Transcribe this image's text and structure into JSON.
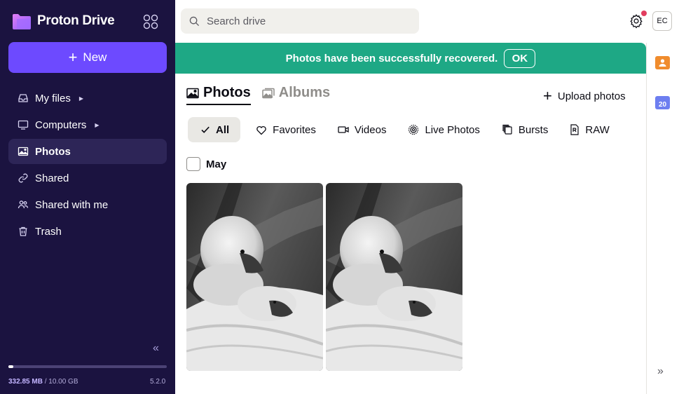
{
  "app": {
    "brand": "Proton Drive",
    "brand_color": "#6d4aff",
    "sidebar_bg": "#1b1340"
  },
  "sidebar": {
    "new_label": "New",
    "items": [
      {
        "label": "My files",
        "icon": "inbox-icon",
        "has_caret": true
      },
      {
        "label": "Computers",
        "icon": "monitor-icon",
        "has_caret": true
      },
      {
        "label": "Photos",
        "icon": "image-icon",
        "active": true
      },
      {
        "label": "Shared",
        "icon": "link-icon"
      },
      {
        "label": "Shared with me",
        "icon": "users-icon"
      },
      {
        "label": "Trash",
        "icon": "trash-icon"
      }
    ],
    "storage_used": "332.85 MB",
    "storage_total": " / 10.00 GB",
    "storage_fraction": 0.033,
    "version": "5.2.0"
  },
  "topbar": {
    "search_placeholder": "Search drive",
    "avatar_initials": "EC",
    "notification_color": "#e23d5f"
  },
  "banner": {
    "message": "Photos have been successfully recovered.",
    "ok_label": "OK",
    "bg_color": "#1ea885"
  },
  "tabs": {
    "photos_label": "Photos",
    "albums_label": "Albums",
    "upload_label": "Upload photos"
  },
  "filters": [
    {
      "label": "All",
      "icon": "check-icon",
      "active": true
    },
    {
      "label": "Favorites",
      "icon": "heart-icon"
    },
    {
      "label": "Videos",
      "icon": "video-icon"
    },
    {
      "label": "Live Photos",
      "icon": "live-photo-icon"
    },
    {
      "label": "Bursts",
      "icon": "bursts-icon"
    },
    {
      "label": "RAW",
      "icon": "raw-file-icon"
    }
  ],
  "month_group": {
    "label": "May",
    "photos": [
      {
        "alt": "Black and white photo of cygnets"
      },
      {
        "alt": "Black and white photo of cygnets"
      }
    ]
  },
  "right_rail": {
    "calendar_day": "20"
  }
}
